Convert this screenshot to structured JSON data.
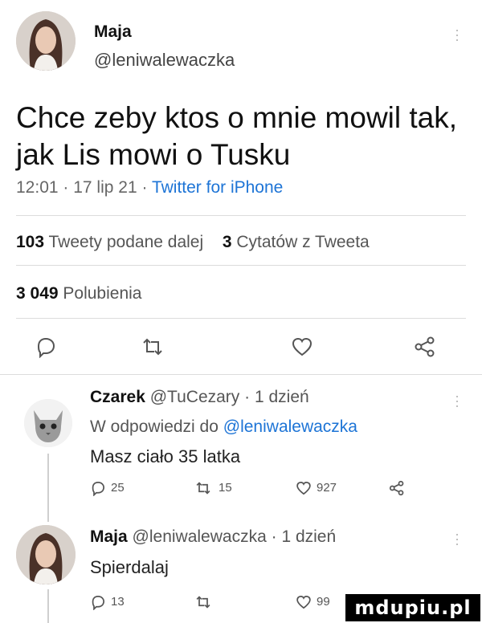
{
  "colors": {
    "link": "#1d74d6",
    "text": "#111111",
    "muted": "#666666",
    "separator": "#dcdcdc"
  },
  "tweet": {
    "author_name": "Maja",
    "author_handle": "@leniwalewaczka",
    "more_icon": "more-vertical-icon",
    "text_line1": "Chce zeby ktos o mnie mowil tak,",
    "text_line2": "jak Lis mowi o Tusku",
    "time": "12:01",
    "date": "17 lip 21",
    "source": "Twitter for iPhone",
    "retweets_count": "103",
    "retweets_label": "Tweety podane dalej",
    "quotes_count": "3",
    "quotes_label": "Cytatów z Tweeta",
    "likes_count": "3 049",
    "likes_label": "Polubienia",
    "actions": [
      "reply-icon",
      "retweet-icon",
      "heart-icon",
      "share-icon"
    ]
  },
  "replies": [
    {
      "author_name": "Czarek",
      "author_handle": "@TuCezary",
      "time_ago": "1 dzień",
      "reply_to_prefix": "W odpowiedzi do",
      "reply_to_handle": "@leniwalewaczka",
      "text": "Masz ciało 35 latka",
      "reply_count": "25",
      "retweet_count": "15",
      "like_count": "927"
    },
    {
      "author_name": "Maja",
      "author_handle": "@leniwalewaczka",
      "time_ago": "1 dzień",
      "text": "Spierdalaj",
      "reply_count": "13",
      "retweet_count": "",
      "like_count": "99"
    }
  ],
  "watermark": "mdupiu.pl"
}
